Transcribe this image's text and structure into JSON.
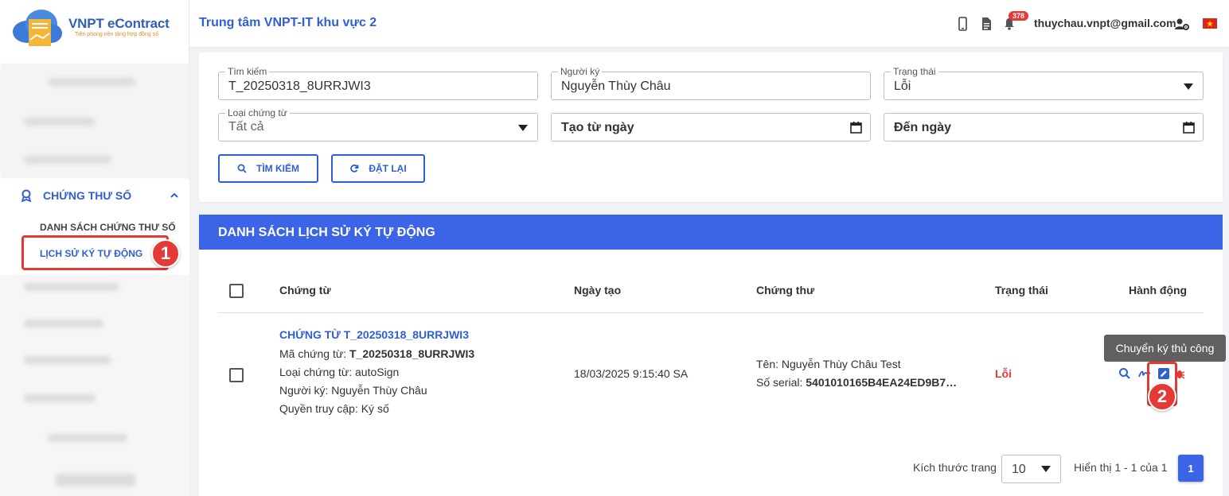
{
  "brand": {
    "title": "VNPT eContract",
    "tagline": "Tiên phong nền tảng hợp đồng số"
  },
  "topbar": {
    "org_name": "Trung tâm VNPT-IT khu vực 2",
    "notif_count": "378",
    "user_email": "thuychau.vnpt@gmail.com"
  },
  "sidebar": {
    "group_label": "CHỨNG THƯ SỐ",
    "items": [
      {
        "label": "DANH SÁCH CHỨNG THƯ SỐ",
        "active": false
      },
      {
        "label": "LỊCH SỬ KÝ TỰ ĐỘNG",
        "active": true
      }
    ]
  },
  "filters": {
    "search": {
      "label": "Tìm kiếm",
      "value": "T_20250318_8URRJWI3"
    },
    "signer": {
      "label": "Người ký",
      "value": "Nguyễn Thùy Châu"
    },
    "status": {
      "label": "Trạng thái",
      "value": "Lỗi"
    },
    "doc_type": {
      "label": "Loại chứng từ",
      "value": "Tất cả"
    },
    "from_date": {
      "placeholder": "Tạo từ ngày"
    },
    "to_date": {
      "placeholder": "Đến ngày"
    },
    "search_button": "TÌM KIẾM",
    "reset_button": "ĐẶT LẠI"
  },
  "list": {
    "title": "DANH SÁCH LỊCH SỬ KÝ TỰ ĐỘNG",
    "columns": [
      "Chứng từ",
      "Ngày tạo",
      "Chứng thư",
      "Trạng thái",
      "Hành động"
    ],
    "rows": [
      {
        "doc_title": "CHỨNG TỪ T_20250318_8URRJWI3",
        "doc_code_label": "Mã chứng từ: ",
        "doc_code": "T_20250318_8URRJWI3",
        "doc_type": "Loại chứng từ: autoSign",
        "signer": "Người ký: Nguyễn Thùy Châu",
        "access": "Quyền truy cập: Ký số",
        "created": "18/03/2025 9:15:40 SA",
        "cert_name": "Tên: Nguyễn Thùy Châu Test",
        "serial_label": "Số serial: ",
        "serial": "5401010165B4EA24ED9B7…",
        "status": "Lỗi"
      }
    ],
    "tooltip": "Chuyển ký thủ công"
  },
  "pagination": {
    "page_size_label": "Kích thước trang",
    "page_size": "10",
    "range_text": "Hiển thị 1 - 1 của 1",
    "current_page": "1"
  },
  "annotations": {
    "step1": "1",
    "step2": "2"
  },
  "colors": {
    "primary": "#2f5fd6",
    "header_blue": "#3b65e6",
    "error_red": "#e53935"
  }
}
